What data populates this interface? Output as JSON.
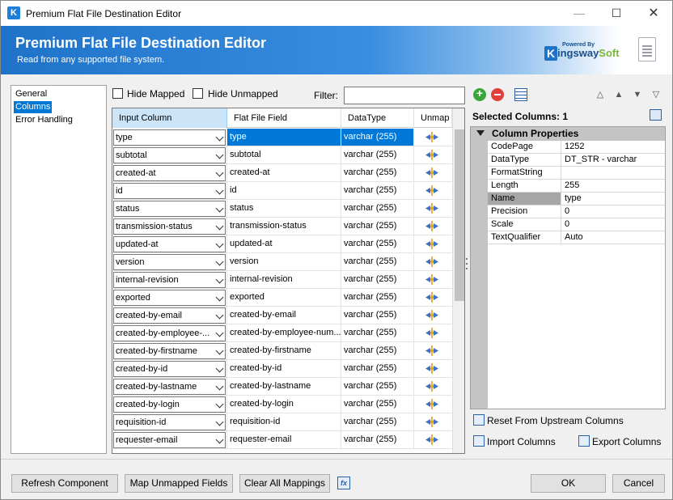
{
  "window": {
    "title": "Premium Flat File Destination Editor",
    "icon_letter": "K"
  },
  "banner": {
    "title": "Premium Flat File Destination Editor",
    "subtitle": "Read from any supported file system.",
    "logo_powered": "Powered By",
    "logo_k": "K",
    "logo_name_main": "ingsway",
    "logo_name_soft": "Soft"
  },
  "nav": {
    "items": [
      {
        "label": "General",
        "selected": false
      },
      {
        "label": "Columns",
        "selected": true
      },
      {
        "label": "Error Handling",
        "selected": false
      }
    ]
  },
  "toolbar": {
    "hide_mapped_label": "Hide Mapped",
    "hide_unmapped_label": "Hide Unmapped",
    "filter_label": "Filter:",
    "filter_value": ""
  },
  "grid": {
    "headers": {
      "input": "Input Column",
      "flat_file": "Flat File Field",
      "datatype": "DataType",
      "unmap": "Unmap"
    },
    "rows": [
      {
        "input": "type",
        "field": "type",
        "datatype": "varchar (255)"
      },
      {
        "input": "subtotal",
        "field": "subtotal",
        "datatype": "varchar (255)"
      },
      {
        "input": "created-at",
        "field": "created-at",
        "datatype": "varchar (255)"
      },
      {
        "input": "id",
        "field": "id",
        "datatype": "varchar (255)"
      },
      {
        "input": "status",
        "field": "status",
        "datatype": "varchar (255)"
      },
      {
        "input": "transmission-status",
        "field": "transmission-status",
        "datatype": "varchar (255)"
      },
      {
        "input": "updated-at",
        "field": "updated-at",
        "datatype": "varchar (255)"
      },
      {
        "input": "version",
        "field": "version",
        "datatype": "varchar (255)"
      },
      {
        "input": "internal-revision",
        "field": "internal-revision",
        "datatype": "varchar (255)"
      },
      {
        "input": "exported",
        "field": "exported",
        "datatype": "varchar (255)"
      },
      {
        "input": "created-by-email",
        "field": "created-by-email",
        "datatype": "varchar (255)"
      },
      {
        "input": "created-by-employee-...",
        "field": "created-by-employee-num...",
        "datatype": "varchar (255)"
      },
      {
        "input": "created-by-firstname",
        "field": "created-by-firstname",
        "datatype": "varchar (255)"
      },
      {
        "input": "created-by-id",
        "field": "created-by-id",
        "datatype": "varchar (255)"
      },
      {
        "input": "created-by-lastname",
        "field": "created-by-lastname",
        "datatype": "varchar (255)"
      },
      {
        "input": "created-by-login",
        "field": "created-by-login",
        "datatype": "varchar (255)"
      },
      {
        "input": "requisition-id",
        "field": "requisition-id",
        "datatype": "varchar (255)"
      },
      {
        "input": "requester-email",
        "field": "requester-email",
        "datatype": "varchar (255)"
      }
    ],
    "selected_row": 0
  },
  "right_panel": {
    "selected_columns_label": "Selected Columns: 1",
    "category": "Column Properties",
    "properties": [
      {
        "name": "CodePage",
        "value": "1252"
      },
      {
        "name": "DataType",
        "value": "DT_STR - varchar"
      },
      {
        "name": "FormatString",
        "value": ""
      },
      {
        "name": "Length",
        "value": "255"
      },
      {
        "name": "Name",
        "value": "type"
      },
      {
        "name": "Precision",
        "value": "0"
      },
      {
        "name": "Scale",
        "value": "0"
      },
      {
        "name": "TextQualifier",
        "value": "Auto"
      }
    ],
    "selected_property": 4,
    "reset_label": "Reset From Upstream Columns",
    "import_label": "Import Columns",
    "export_label": "Export Columns"
  },
  "footer": {
    "refresh_label": "Refresh Component",
    "map_unmapped_label": "Map Unmapped Fields",
    "clear_mappings_label": "Clear All Mappings",
    "fx_label": "fx",
    "ok_label": "OK",
    "cancel_label": "Cancel"
  },
  "colors": {
    "accent": "#0078d7",
    "banner": "#1e73c9",
    "brand_soft": "#7ab63a"
  }
}
